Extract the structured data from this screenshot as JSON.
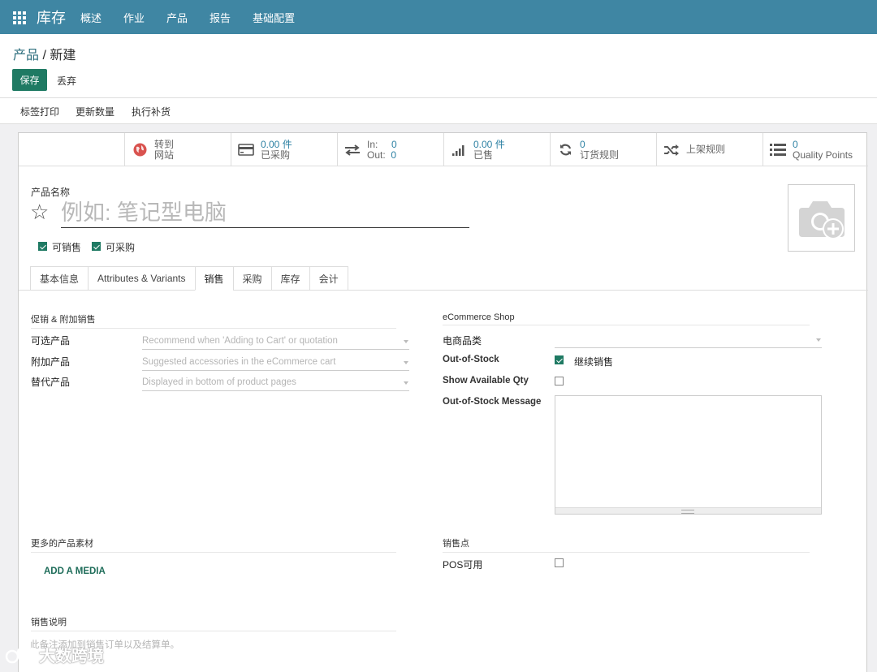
{
  "nav": {
    "app_title": "库存",
    "menu": [
      "概述",
      "作业",
      "产品",
      "报告",
      "基础配置"
    ]
  },
  "breadcrumb": {
    "parent": "产品",
    "separator": " / ",
    "current": "新建"
  },
  "buttons": {
    "save": "保存",
    "discard": "丢弃"
  },
  "actions": [
    "标签打印",
    "更新数量",
    "执行补货"
  ],
  "smart_buttons": {
    "website": {
      "line1": "转到",
      "line2": "网站",
      "icon": "globe-icon"
    },
    "purchased": {
      "value": "0.00 件",
      "label": "已采购",
      "icon": "credit-card-icon"
    },
    "inout": {
      "in_label": "In:",
      "in_value": "0",
      "out_label": "Out:",
      "out_value": "0",
      "icon": "exchange-icon"
    },
    "sold": {
      "value": "0.00 件",
      "label": "已售",
      "icon": "signal-icon"
    },
    "reorder": {
      "value": "0",
      "label": "订货规则",
      "icon": "refresh-icon"
    },
    "putaway": {
      "label": "上架规则",
      "icon": "random-icon"
    },
    "quality": {
      "value": "0",
      "label": "Quality Points",
      "icon": "list-icon"
    }
  },
  "product": {
    "name_label": "产品名称",
    "name_placeholder": "例如: 笔记型电脑",
    "can_be_sold_label": "可销售",
    "can_be_sold": true,
    "can_be_purchased_label": "可采购",
    "can_be_purchased": true
  },
  "tabs": [
    {
      "label": "基本信息",
      "active": false
    },
    {
      "label": "Attributes & Variants",
      "active": false
    },
    {
      "label": "销售",
      "active": true
    },
    {
      "label": "采购",
      "active": false
    },
    {
      "label": "库存",
      "active": false
    },
    {
      "label": "会计",
      "active": false
    }
  ],
  "upsell": {
    "title": "促销 & 附加销售",
    "optional_label": "可选产品",
    "optional_placeholder": "Recommend when 'Adding to Cart' or quotation",
    "accessory_label": "附加产品",
    "accessory_placeholder": "Suggested accessories in the eCommerce cart",
    "alternative_label": "替代产品",
    "alternative_placeholder": "Displayed in bottom of product pages"
  },
  "ecommerce": {
    "title": "eCommerce Shop",
    "category_label": "电商品类",
    "oos_label": "Out-of-Stock",
    "oos_checked": true,
    "oos_value": "继续销售",
    "show_qty_label": "Show Available Qty",
    "show_qty_checked": false,
    "oos_message_label": "Out-of-Stock Message"
  },
  "media": {
    "title": "更多的产品素材",
    "add_button": "ADD A MEDIA"
  },
  "pos": {
    "title": "销售点",
    "available_label": "POS可用",
    "available_checked": false
  },
  "sales_description": {
    "title": "销售说明",
    "placeholder": "此备注添加到销售订单以及结算单。"
  },
  "watermark": {
    "text": "大数跨境"
  },
  "colors": {
    "nav": "#3f86a3",
    "primary": "#1f7a63",
    "link": "#2d81a3"
  }
}
